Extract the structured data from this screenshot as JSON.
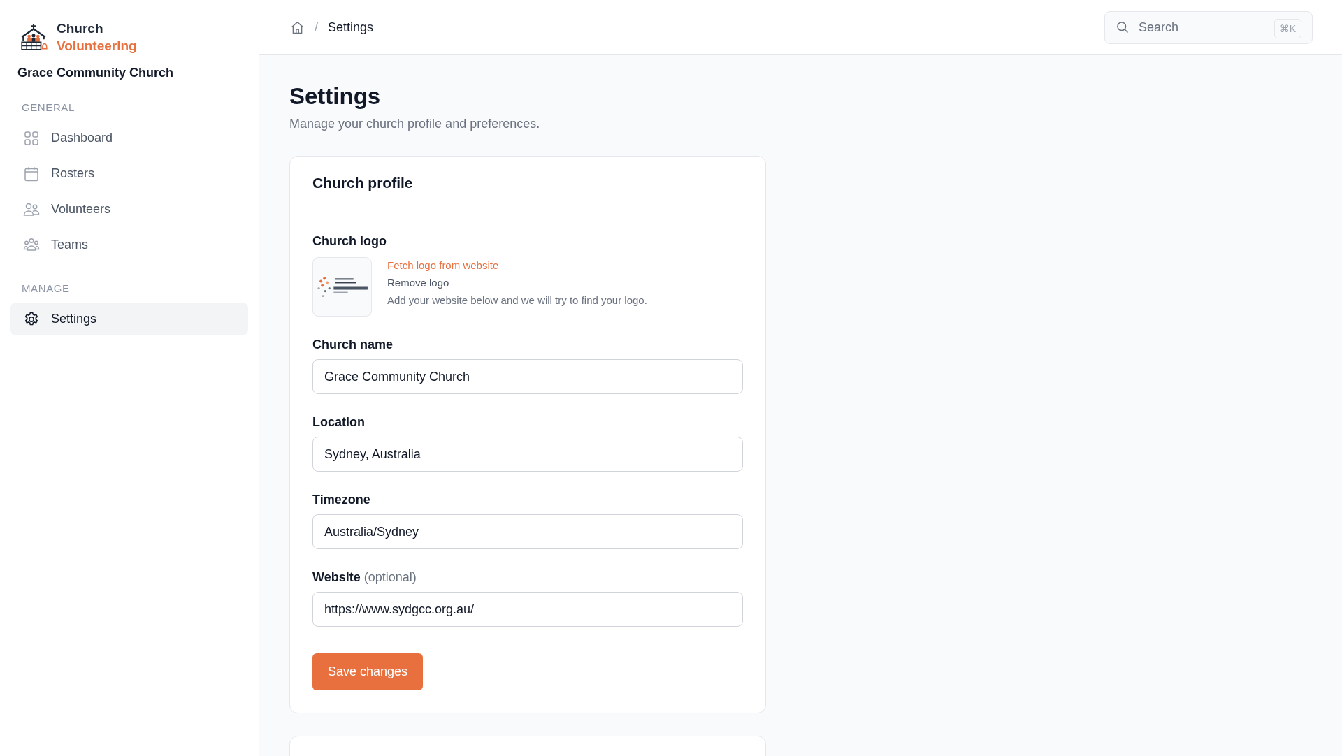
{
  "app": {
    "name_line_1": "Church",
    "name_line_2": "Volunteering",
    "organization": "Grace Community Church"
  },
  "sidebar": {
    "sections": [
      {
        "heading": "GENERAL",
        "items": [
          {
            "label": "Dashboard",
            "kind": "grid",
            "selected": false
          },
          {
            "label": "Rosters",
            "kind": "calendar",
            "selected": false
          },
          {
            "label": "Volunteers",
            "kind": "users",
            "selected": false
          },
          {
            "label": "Teams",
            "kind": "group",
            "selected": false
          }
        ]
      },
      {
        "heading": "MANAGE",
        "items": [
          {
            "label": "Settings",
            "kind": "gear",
            "selected": true
          }
        ]
      }
    ]
  },
  "breadcrumb": {
    "separator": "/",
    "current": "Settings"
  },
  "search": {
    "placeholder": "Search",
    "shortcut": "⌘K"
  },
  "page": {
    "title": "Settings",
    "subtitle": "Manage your church profile and preferences."
  },
  "card": {
    "title": "Church profile",
    "logo": {
      "label": "Church logo",
      "fetch_link": "Fetch logo from website",
      "remove_link": "Remove logo",
      "hint": "Add your website below and we will try to find your logo."
    },
    "fields": [
      {
        "label": "Church name",
        "value": "Grace Community Church"
      },
      {
        "label": "Location",
        "value": "Sydney, Australia"
      },
      {
        "label": "Timezone",
        "value": "Australia/Sydney"
      },
      {
        "label": "Website",
        "optional_note": "(optional)",
        "value": "https://www.sydgcc.org.au/"
      }
    ],
    "save_button": "Save changes"
  }
}
